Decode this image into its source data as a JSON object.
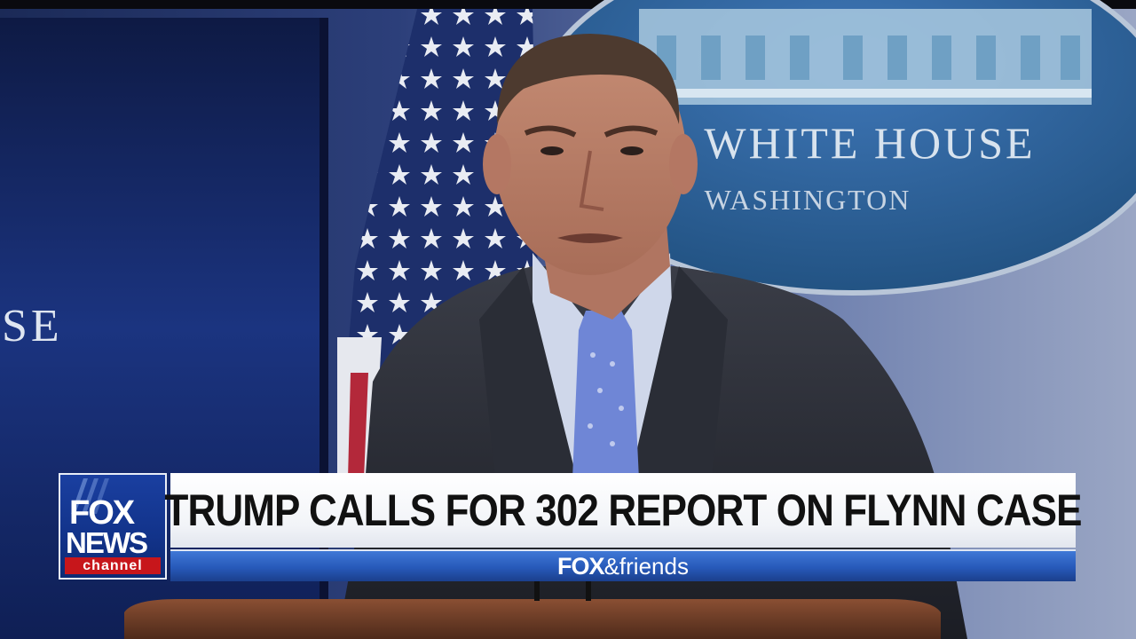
{
  "background_sign": {
    "seal_line1": "WHITE HOUSE",
    "seal_line2": "WASHINGTON",
    "left_panel_text": "SE"
  },
  "lower_third": {
    "logo": {
      "line1": "FOX",
      "line2": "NEWS",
      "line3": "channel"
    },
    "headline": "TRUMP CALLS FOR 302 REPORT ON FLYNN CASE",
    "show": {
      "brand": "FOX",
      "name": "&friends"
    }
  },
  "colors": {
    "logo_blue": "#12338a",
    "channel_red": "#c7161b",
    "show_bar_blue": "#2759b9"
  }
}
